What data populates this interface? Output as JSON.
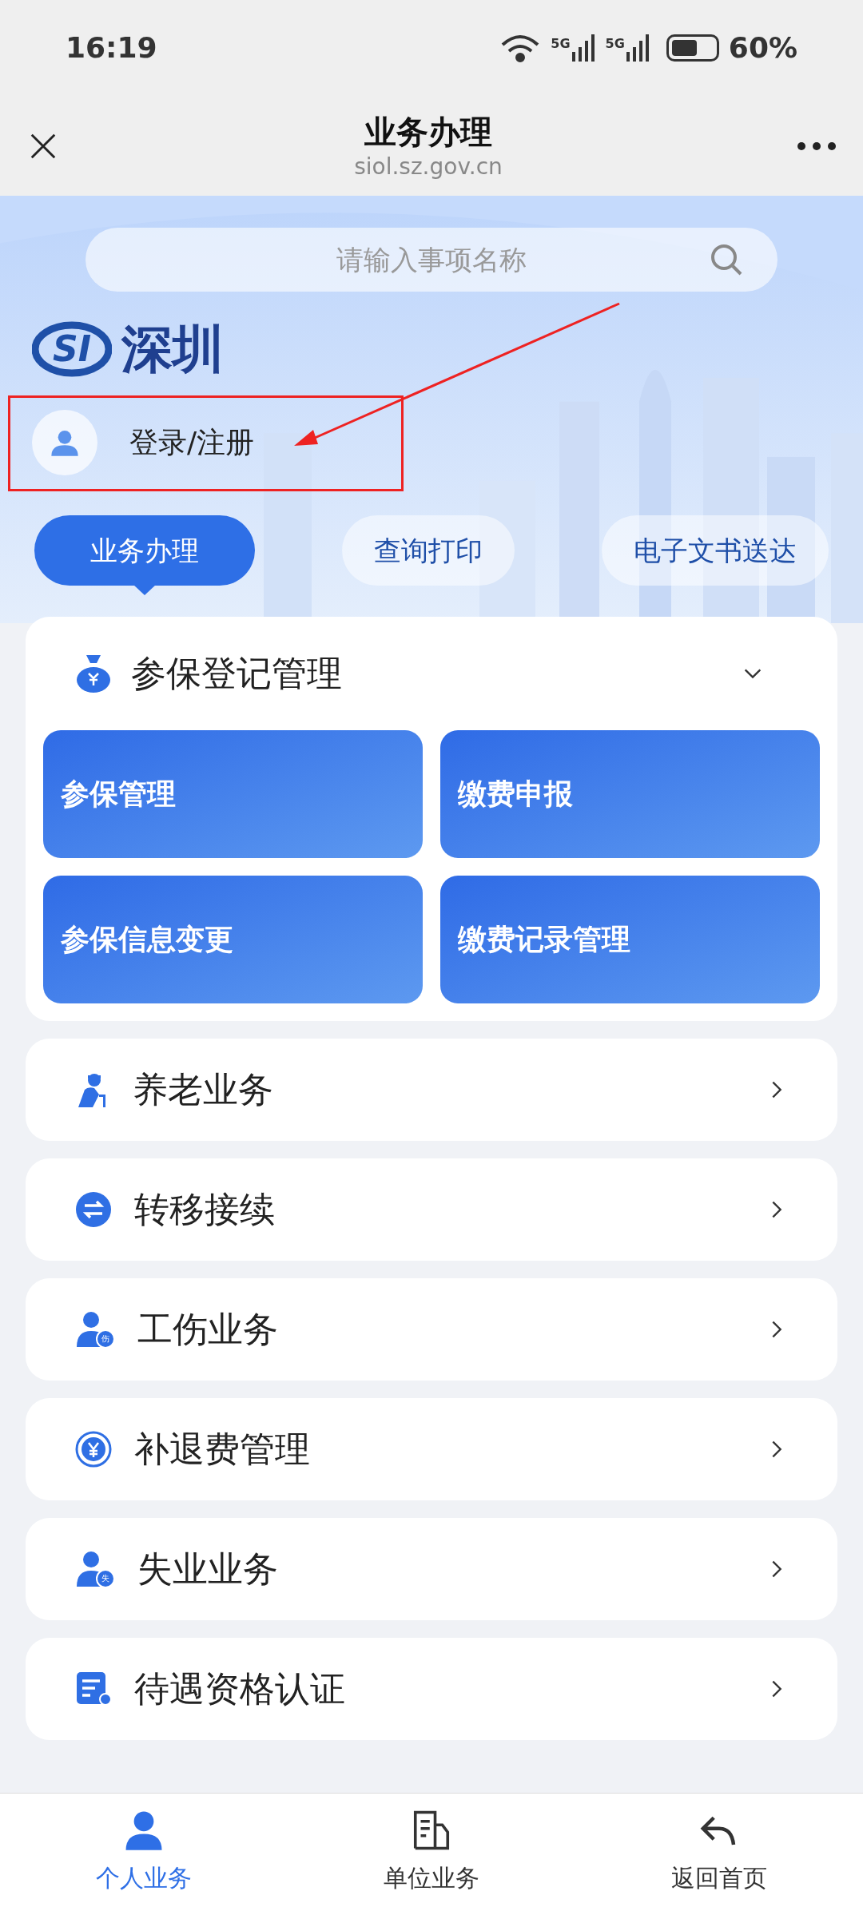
{
  "status_bar": {
    "time": "16:19",
    "networks": [
      "5G",
      "5G"
    ],
    "battery": "60%"
  },
  "header": {
    "title": "业务办理",
    "url": "siol.sz.gov.cn"
  },
  "search": {
    "placeholder": "请输入事项名称"
  },
  "logo": {
    "emblem": "SI",
    "text": "深圳"
  },
  "login": {
    "label": "登录/注册"
  },
  "tabs": [
    {
      "label": "业务办理",
      "selected": true
    },
    {
      "label": "查询打印",
      "selected": false
    },
    {
      "label": "电子文书送达",
      "selected": false
    }
  ],
  "section": {
    "title": "参保登记管理",
    "expanded": true,
    "tiles": [
      "参保管理",
      "缴费申报",
      "参保信息变更",
      "缴费记录管理"
    ]
  },
  "list": [
    {
      "label": "养老业务"
    },
    {
      "label": "转移接续"
    },
    {
      "label": "工伤业务",
      "badge": "伤"
    },
    {
      "label": "补退费管理"
    },
    {
      "label": "失业业务",
      "badge": "失"
    },
    {
      "label": "待遇资格认证"
    }
  ],
  "bottom_nav": [
    {
      "label": "个人业务",
      "selected": true
    },
    {
      "label": "单位业务",
      "selected": false
    },
    {
      "label": "返回首页",
      "selected": false
    }
  ]
}
